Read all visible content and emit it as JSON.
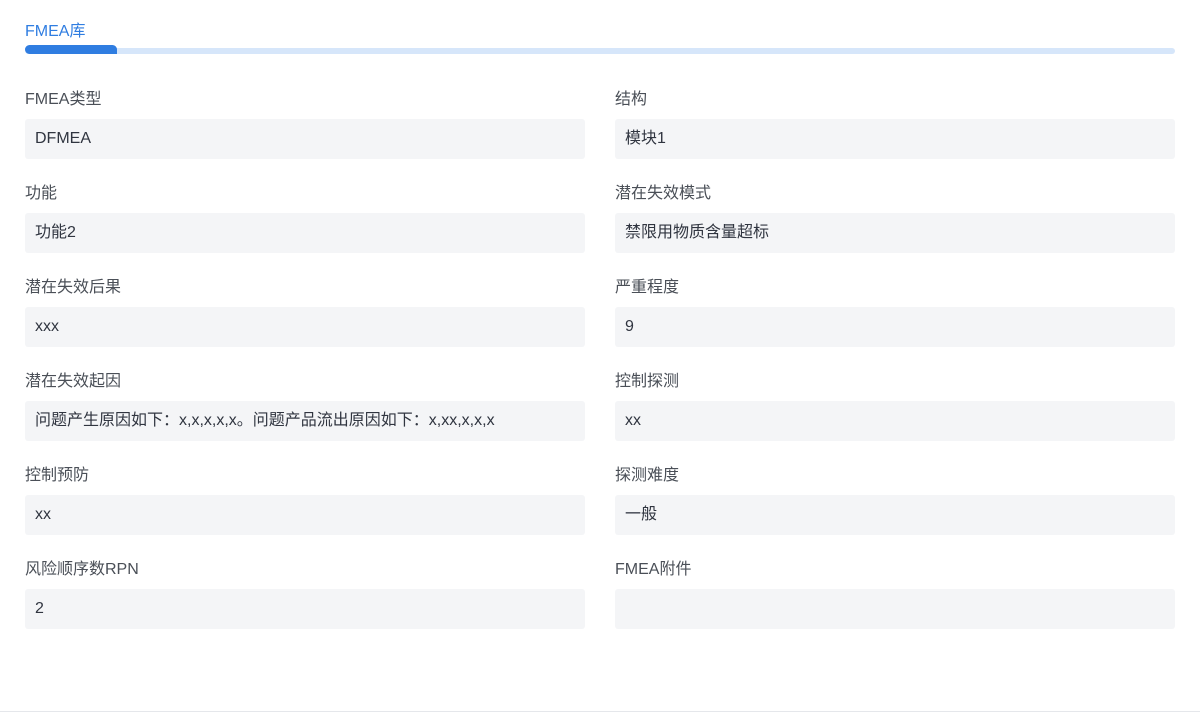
{
  "tab": {
    "label": "FMEA库",
    "accent": "#2f7de1"
  },
  "fields": [
    {
      "label": "FMEA类型",
      "value": "DFMEA"
    },
    {
      "label": "结构",
      "value": "模块1"
    },
    {
      "label": "功能",
      "value": "功能2"
    },
    {
      "label": "潜在失效模式",
      "value": "禁限用物质含量超标"
    },
    {
      "label": "潜在失效后果",
      "value": "xxx"
    },
    {
      "label": "严重程度",
      "value": "9"
    },
    {
      "label": "潜在失效起因",
      "value": "问题产生原因如下：x,x,x,x,x。问题产品流出原因如下：x,xx,x,x,x"
    },
    {
      "label": "控制探测",
      "value": "xx"
    },
    {
      "label": "控制预防",
      "value": "xx"
    },
    {
      "label": "探测难度",
      "value": "一般"
    },
    {
      "label": "风险顺序数RPN",
      "value": "2"
    },
    {
      "label": "FMEA附件",
      "value": ""
    }
  ]
}
